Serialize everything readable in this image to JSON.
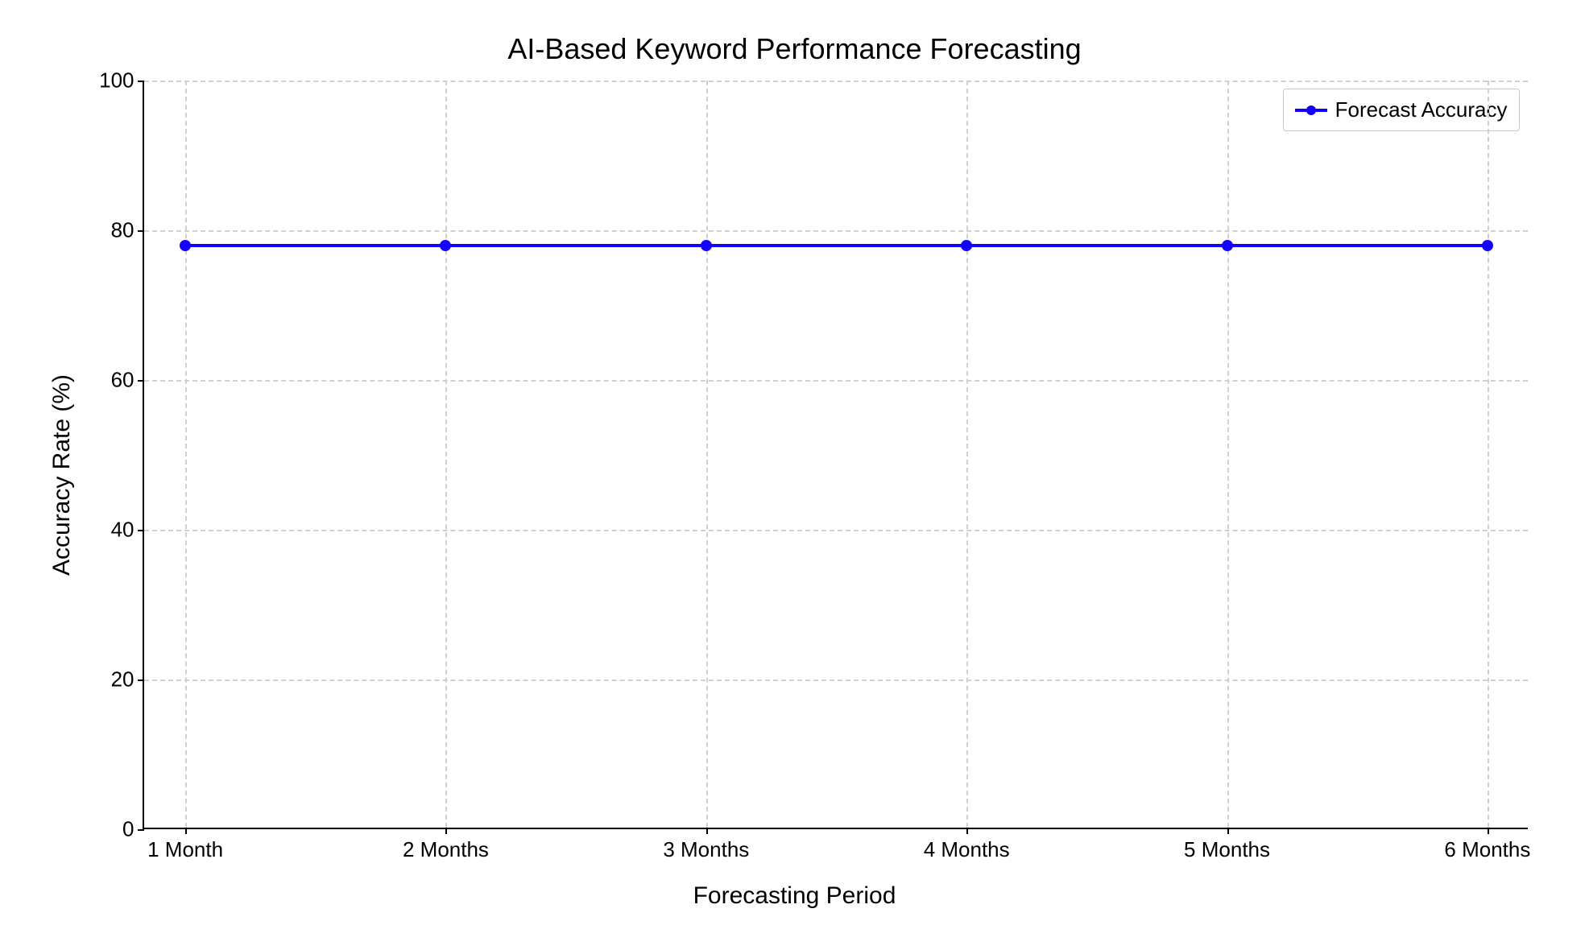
{
  "chart_data": {
    "type": "line",
    "title": "AI-Based Keyword Performance Forecasting",
    "xlabel": "Forecasting Period",
    "ylabel": "Accuracy Rate (%)",
    "categories": [
      "1 Month",
      "2 Months",
      "3 Months",
      "4 Months",
      "5 Months",
      "6 Months"
    ],
    "series": [
      {
        "name": "Forecast Accuracy",
        "values": [
          78,
          78,
          78,
          78,
          78,
          78
        ]
      }
    ],
    "ylim": [
      0,
      100
    ],
    "y_ticks": [
      0,
      20,
      40,
      60,
      80,
      100
    ],
    "grid": true,
    "legend_position": "upper right",
    "line_color": "#1400ff"
  }
}
